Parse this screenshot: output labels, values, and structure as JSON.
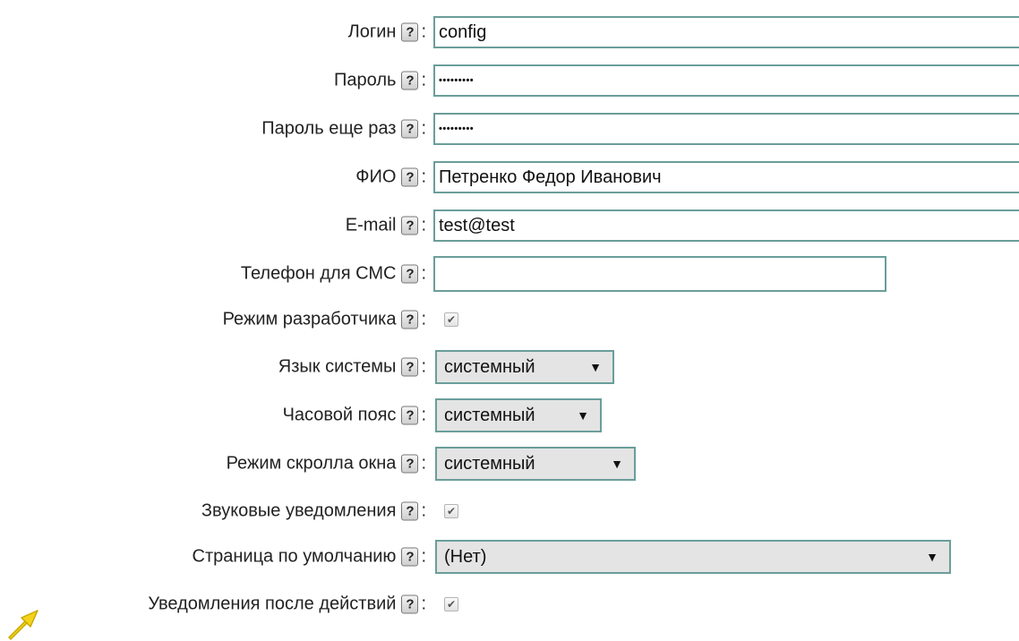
{
  "form": {
    "help_glyph": "?",
    "colon": ":",
    "login": {
      "label": "Логин",
      "value": "config"
    },
    "password": {
      "label": "Пароль",
      "value": "•••••••••"
    },
    "password_repeat": {
      "label": "Пароль еще раз",
      "value": "•••••••••"
    },
    "full_name": {
      "label": "ФИО",
      "value": "Петренко Федор Иванович"
    },
    "email": {
      "label": "E-mail",
      "value": "test@test"
    },
    "sms_phone": {
      "label": "Телефон для СМС",
      "value": ""
    },
    "developer_mode": {
      "label": "Режим разработчика",
      "checked": true
    },
    "system_language": {
      "label": "Язык системы",
      "value": "системный"
    },
    "timezone": {
      "label": "Часовой пояс",
      "value": "системный"
    },
    "scroll_mode": {
      "label": "Режим скролла окна",
      "value": "системный"
    },
    "sound_notifications": {
      "label": "Звуковые уведомления",
      "checked": true
    },
    "default_page": {
      "label": "Страница по умолчанию",
      "value": "(Нет)"
    },
    "action_notifications": {
      "label": "Уведомления после действий",
      "checked": true
    }
  },
  "icons": {
    "help": "question-mark-icon",
    "checkbox_mark": "✔",
    "dropdown": "▼",
    "pointer": "yellow-arrow-icon"
  },
  "colors": {
    "field_border": "#6a9e9a",
    "select_background": "#e4e4e4",
    "pointer": "#f3d41a"
  }
}
